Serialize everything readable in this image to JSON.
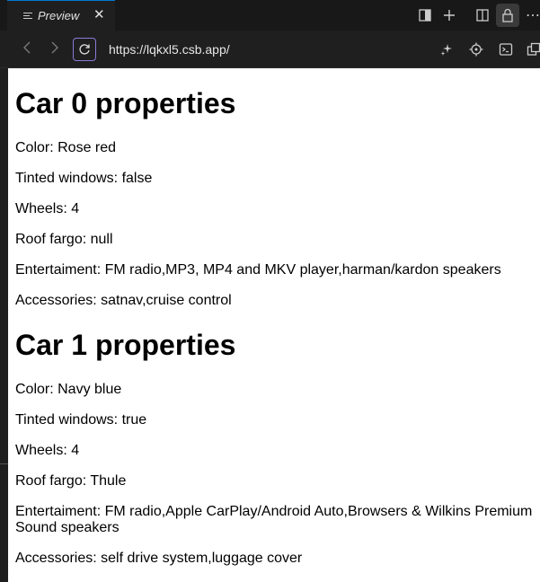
{
  "tab": {
    "title": "Preview",
    "close": "✕"
  },
  "toolbar": {
    "more": "⋯"
  },
  "address": {
    "url": "https://lqkxl5.csb.app/"
  },
  "cars": [
    {
      "heading": "Car 0 properties",
      "color": "Color: Rose red",
      "tinted": "Tinted windows: false",
      "wheels": "Wheels: 4",
      "roof": "Roof fargo: null",
      "entertainment": "Entertaiment: FM radio,MP3, MP4 and MKV player,harman/kardon speakers",
      "accessories": "Accessories: satnav,cruise control"
    },
    {
      "heading": "Car 1 properties",
      "color": "Color: Navy blue",
      "tinted": "Tinted windows: true",
      "wheels": "Wheels: 4",
      "roof": "Roof fargo: Thule",
      "entertainment": "Entertaiment: FM radio,Apple CarPlay/Android Auto,Browsers & Wilkins Premium Sound speakers",
      "accessories": "Accessories: self drive system,luggage cover"
    }
  ]
}
